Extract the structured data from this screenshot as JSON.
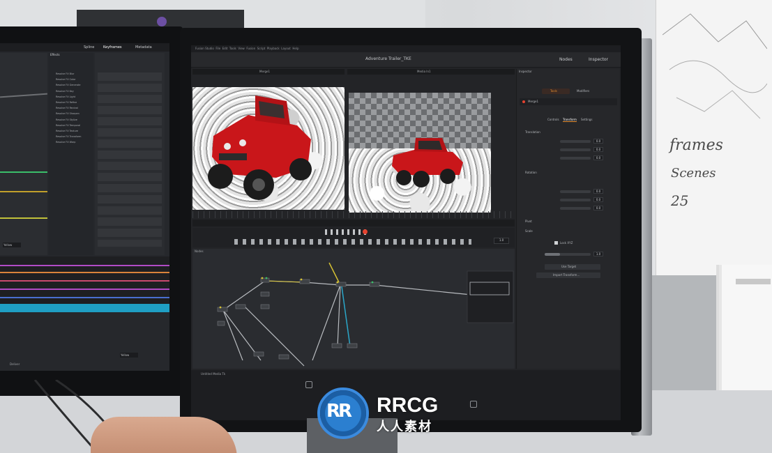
{
  "app": {
    "window_title": "Adventure Trailer_TKE",
    "menu": [
      "Fusion Studio",
      "File",
      "Edit",
      "Tools",
      "View",
      "Fusion",
      "Script",
      "Playback",
      "Layout",
      "Help"
    ],
    "toolbar_right": [
      "Nodes",
      "Inspector"
    ],
    "viewer_left_label": "Merge1",
    "viewer_right_label": "Media In1",
    "zoom_value": "1.0",
    "nodes_panel_label": "Nodes",
    "inspector_label": "Inspector",
    "inspector_tabs": [
      "Tools",
      "Modifiers"
    ],
    "node_name": "Merge1",
    "inspector_subtabs": [
      "Controls",
      "Transform",
      "Settings"
    ],
    "sections": [
      "Translation",
      "Rotation",
      "Pivot",
      "Scale"
    ],
    "translation_values": [
      "0.0",
      "0.0",
      "0.0"
    ],
    "rotation_values": [
      "0.0",
      "0.0",
      "0.0"
    ],
    "scale_value": "1.0",
    "buttons": [
      "Use Target",
      "Import Transform..."
    ],
    "checkbox_label": "Lock XYZ",
    "status_text": "Untitled Media Tk"
  },
  "left_app": {
    "tabs": [
      "Spline",
      "Keyframes",
      "Metadata"
    ],
    "effects_label": "Effects",
    "list_items": [
      "Resolve FX Blur",
      "Resolve FX Color",
      "Resolve FX Generate",
      "Resolve FX Key",
      "Resolve FX Light",
      "Resolve FX Refine",
      "Resolve FX Revival",
      "Resolve FX Sharpen",
      "Resolve FX Stylize",
      "Resolve FX Temporal",
      "Resolve FX Texture",
      "Resolve FX Transform",
      "Resolve FX Warp"
    ],
    "dropdown_value": "Yellow",
    "footer_label": "Deliver"
  },
  "watermark": {
    "logo_letters": "RR",
    "brand": "RRCG",
    "chinese": "人人素材"
  },
  "background": {
    "handwriting": [
      "frames",
      "Scenes",
      "25"
    ]
  },
  "colors": {
    "jeep_red": "#c9161a",
    "accent_orange": "#e38a2c",
    "node_yellow": "#d6c233",
    "node_cyan": "#2aa6c8",
    "watermark_blue": "#2b7fd0"
  }
}
